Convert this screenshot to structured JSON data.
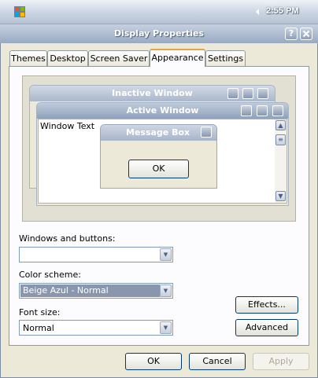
{
  "taskbar": {
    "clock": "2:55 PM"
  },
  "window": {
    "title": "Display Properties",
    "help_label": "?",
    "close_label": "X"
  },
  "tabs": [
    {
      "label": "Themes"
    },
    {
      "label": "Desktop"
    },
    {
      "label": "Screen Saver"
    },
    {
      "label": "Appearance",
      "active": true
    },
    {
      "label": "Settings"
    }
  ],
  "preview": {
    "inactive_title": "Inactive Window",
    "active_title": "Active Window",
    "window_text": "Window Text",
    "message_box_title": "Message Box",
    "ok_label": "OK"
  },
  "form": {
    "windows_buttons_label": "Windows and buttons:",
    "windows_buttons_value": "",
    "color_scheme_label": "Color scheme:",
    "color_scheme_value": "Beige Azul - Normal",
    "font_size_label": "Font size:",
    "font_size_value": "Normal",
    "effects_label": "Effects...",
    "advanced_label": "Advanced"
  },
  "footer": {
    "ok_label": "OK",
    "cancel_label": "Cancel",
    "apply_label": "Apply"
  },
  "colors": {
    "accent": "#e4a440",
    "selection": "#8996ad",
    "titlebar": "#98a9c1"
  }
}
